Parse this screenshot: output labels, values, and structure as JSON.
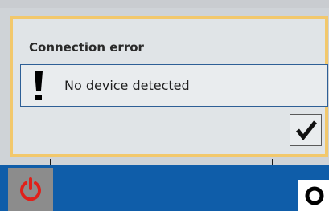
{
  "dialog": {
    "title": "Connection error",
    "message": "No device detected",
    "icon": "exclamation-icon",
    "confirm_icon": "checkmark-icon"
  },
  "taskbar": {
    "power_icon": "power-icon",
    "right_icon": "circle-icon"
  },
  "colors": {
    "dialog_border": "#f2c86c",
    "message_border": "#2e5f96",
    "taskbar": "#0f5da9",
    "power_icon": "#e0201a"
  }
}
